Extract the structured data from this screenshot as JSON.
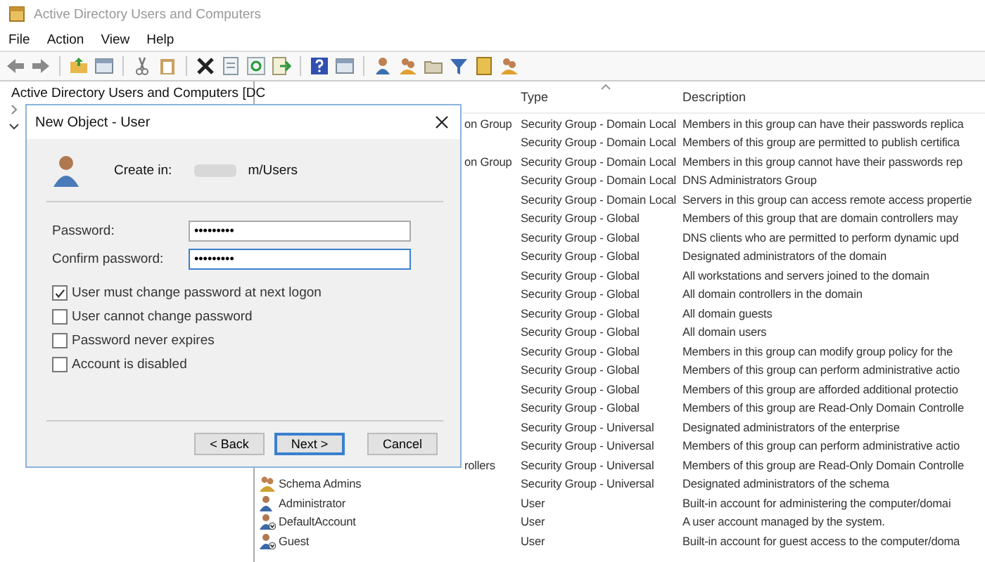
{
  "window": {
    "title": "Active Directory Users and Computers"
  },
  "menu": [
    "File",
    "Action",
    "View",
    "Help"
  ],
  "tree": {
    "label": "Active Directory Users and Computers [DC",
    "items": [
      {
        "expanded": false
      },
      {
        "expanded": true
      }
    ]
  },
  "list": {
    "columns": [
      "Type",
      "Description"
    ],
    "rows": [
      {
        "name": "on Group",
        "type": "Security Group - Domain Local",
        "description": "Members in this group can have their passwords replica"
      },
      {
        "type": "Security Group - Domain Local",
        "description": "Members of this group are permitted to publish certifica"
      },
      {
        "name": "on Group",
        "type": "Security Group - Domain Local",
        "description": "Members in this group cannot have their passwords rep"
      },
      {
        "type": "Security Group - Domain Local",
        "description": "DNS Administrators Group"
      },
      {
        "type": "Security Group - Domain Local",
        "description": "Servers in this group can access remote access propertie"
      },
      {
        "type": "Security Group - Global",
        "description": "Members of this group that are domain controllers may"
      },
      {
        "type": "Security Group - Global",
        "description": "DNS clients who are permitted to perform dynamic upd"
      },
      {
        "type": "Security Group - Global",
        "description": "Designated administrators of the domain"
      },
      {
        "type": "Security Group - Global",
        "description": "All workstations and servers joined to the domain"
      },
      {
        "type": "Security Group - Global",
        "description": "All domain controllers in the domain"
      },
      {
        "type": "Security Group - Global",
        "description": "All domain guests"
      },
      {
        "type": "Security Group - Global",
        "description": "All domain users"
      },
      {
        "type": "Security Group - Global",
        "description": "Members in this group can modify group policy for the"
      },
      {
        "type": "Security Group - Global",
        "description": "Members of this group can perform administrative actio"
      },
      {
        "type": "Security Group - Global",
        "description": "Members of this group are afforded additional protectio"
      },
      {
        "type": "Security Group - Global",
        "description": "Members of this group are Read-Only Domain Controlle"
      },
      {
        "type": "Security Group - Universal",
        "description": "Designated administrators of the enterprise"
      },
      {
        "type": "Security Group - Universal",
        "description": "Members of this group can perform administrative actio"
      },
      {
        "name": "rollers",
        "type": "Security Group - Universal",
        "description": "Members of this group are Read-Only Domain Controlle"
      },
      {
        "name": "Schema Admins",
        "kind": "group",
        "type": "Security Group - Universal",
        "description": "Designated administrators of the schema"
      },
      {
        "name": "Administrator",
        "kind": "user",
        "type": "User",
        "description": "Built-in account for administering the computer/domai"
      },
      {
        "name": "DefaultAccount",
        "kind": "user",
        "disabled": true,
        "type": "User",
        "description": "A user account managed by the system."
      },
      {
        "name": "Guest",
        "kind": "user",
        "disabled": true,
        "type": "User",
        "description": "Built-in account for guest access to the computer/doma"
      }
    ]
  },
  "dialog": {
    "title": "New Object - User",
    "create_in_label": "Create in:",
    "create_in_value": "m/Users",
    "fields": [
      {
        "label": "Password:",
        "value": "•••••••••",
        "focused": false
      },
      {
        "label": "Confirm password:",
        "value": "•••••••••",
        "focused": true
      }
    ],
    "checkboxes": [
      {
        "label": "User must change password at next logon",
        "checked": true
      },
      {
        "label": "User cannot change password",
        "checked": false
      },
      {
        "label": "Password never expires",
        "checked": false
      },
      {
        "label": "Account is disabled",
        "checked": false
      }
    ],
    "buttons": [
      {
        "label": "< Back",
        "default": false
      },
      {
        "label": "Next >",
        "default": true
      },
      {
        "label": "Cancel",
        "default": false
      }
    ]
  }
}
